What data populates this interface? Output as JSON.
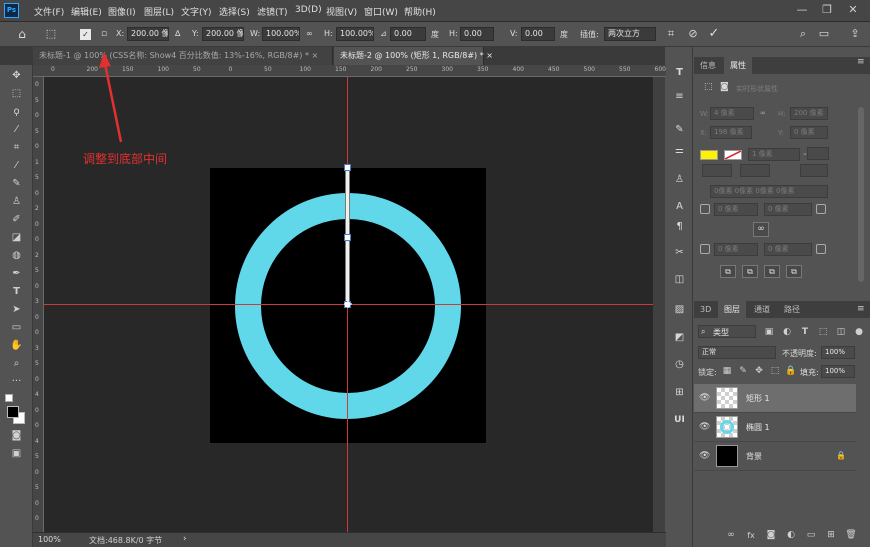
{
  "app": {
    "logo": "Ps"
  },
  "menu": [
    "文件(F)",
    "编辑(E)",
    "图像(I)",
    "图层(L)",
    "文字(Y)",
    "选择(S)",
    "滤镜(T)",
    "3D(D)",
    "视图(V)",
    "窗口(W)",
    "帮助(H)"
  ],
  "window_controls": {
    "minimize": "—",
    "restore": "❐",
    "close": "✕"
  },
  "options": {
    "x_label": "X:",
    "x_value": "200.00 像素",
    "y_label": "Y:",
    "y_value": "200.00 像素",
    "w_label": "W:",
    "w_value": "100.00%",
    "h_label": "H:",
    "h_value": "100.00%",
    "angle_value": "0.00",
    "angle_unit": "度",
    "hskew_label": "H:",
    "hskew_value": "0.00",
    "vskew_label": "V:",
    "vskew_value": "0.00",
    "skew_unit": "度",
    "interp_label": "插值:",
    "interp_value": "两次立方"
  },
  "tabs": [
    {
      "label": "未标题-1 @ 100% (CSS名称: Show4  百分比数值: 13%-16%, RGB/8#) *",
      "close": "×"
    },
    {
      "label": "未标题-2 @ 100% (矩形 1, RGB/8#) *",
      "close": "×"
    }
  ],
  "ruler": {
    "h_ticks": [
      "0",
      "200",
      "150",
      "100",
      "50",
      "0",
      "50",
      "100",
      "150",
      "200",
      "250",
      "300",
      "350",
      "400",
      "450",
      "500",
      "550",
      "600"
    ],
    "v_ticks": [
      "0",
      "5",
      "0",
      "5",
      "0",
      "1",
      "5",
      "0",
      "2",
      "0",
      "0",
      "2",
      "5",
      "0",
      "3",
      "0",
      "0",
      "3",
      "5",
      "0",
      "4",
      "0",
      "0",
      "4",
      "5",
      "0",
      "5",
      "0",
      "0"
    ]
  },
  "annotation": "调整到底部中间",
  "status": {
    "zoom": "100%",
    "doc": "文档:468.8K/0 字节"
  },
  "colors": {
    "ring": "#61d8ea",
    "guide": "#ce3a3a",
    "annotation": "#e23030",
    "fill_swatch": "#fff200"
  },
  "properties_panel": {
    "tabs": [
      "信息",
      "属性"
    ],
    "title": "实时形状属性",
    "w_label": "W:",
    "w_value": "4 像素",
    "h_label": "H:",
    "h_value": "200 像素",
    "x_label": "X:",
    "x_value": "198 像素",
    "y_label": "Y:",
    "y_value": "0 像素",
    "stroke_width": "1 像素",
    "radius_all": "0像素 0像素 0像素 0像素",
    "r1": "0 像素",
    "r2": "0 像素",
    "r3": "0 像素",
    "r4": "0 像素"
  },
  "layers_panel": {
    "tabs": [
      "3D",
      "图层",
      "通道",
      "路径"
    ],
    "filter_label": "类型",
    "blend_mode": "正常",
    "opacity_label": "不透明度:",
    "opacity_value": "100%",
    "lock_label": "锁定:",
    "fill_label": "填充:",
    "fill_value": "100%",
    "layers": [
      {
        "name": "矩形 1",
        "selected": true
      },
      {
        "name": "椭圆 1",
        "selected": false
      },
      {
        "name": "背景",
        "selected": false
      }
    ]
  }
}
